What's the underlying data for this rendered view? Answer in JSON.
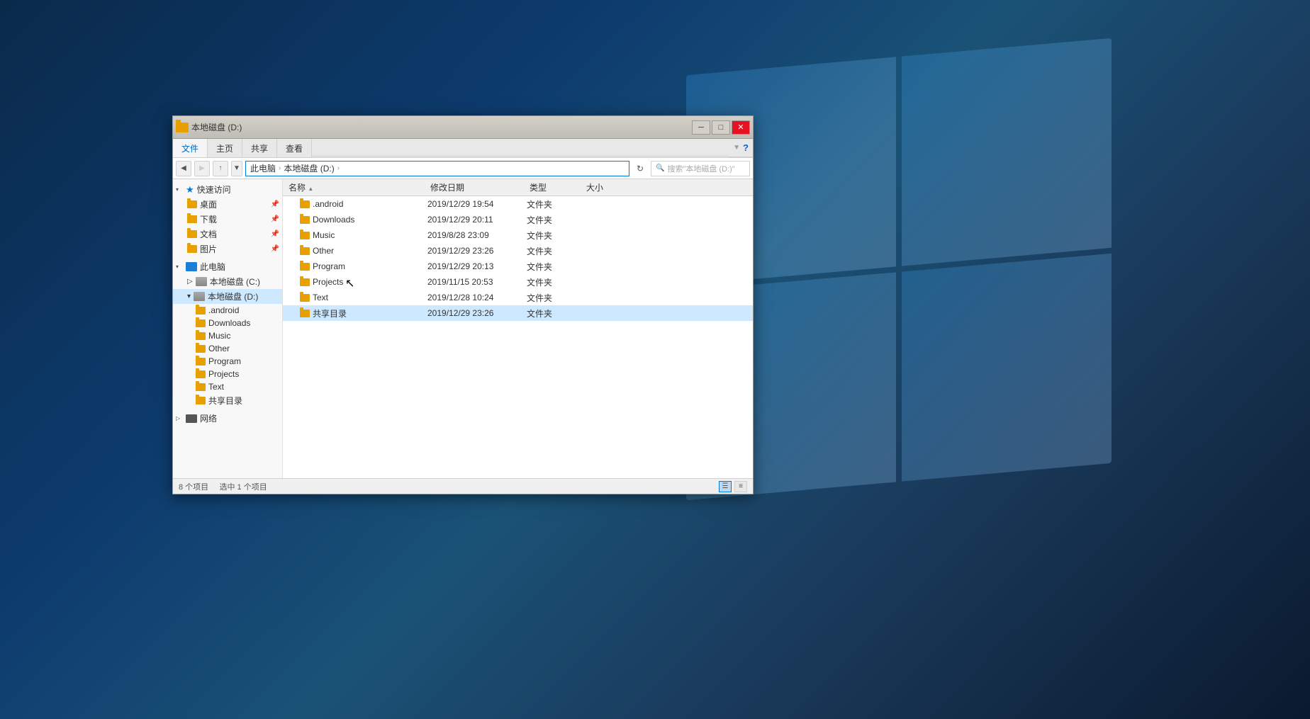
{
  "background": {
    "description": "Windows 10 desktop background - dark blue gradient with Windows logo"
  },
  "window": {
    "title": "本地磁盘 (D:)",
    "title_prefix": "本地磁盘 (D:)"
  },
  "title_bar": {
    "minimize": "─",
    "maximize": "□",
    "close": "✕"
  },
  "ribbon_tabs": [
    {
      "label": "文件",
      "active": true
    },
    {
      "label": "主页",
      "active": false
    },
    {
      "label": "共享",
      "active": false
    },
    {
      "label": "查看",
      "active": false
    }
  ],
  "address_bar": {
    "back": "←",
    "forward": "→",
    "up": "↑",
    "recent": "▼",
    "breadcrumbs": [
      "此电脑",
      "本地磁盘 (D:)"
    ],
    "refresh": "↻",
    "search_placeholder": "搜索\"本地磁盘 (D:)\""
  },
  "sidebar": {
    "sections": [
      {
        "header": "快速访问",
        "icon": "star",
        "expanded": true,
        "items": [
          {
            "label": "桌面",
            "pinned": true
          },
          {
            "label": "下载",
            "pinned": true
          },
          {
            "label": "文档",
            "pinned": true
          },
          {
            "label": "图片",
            "pinned": true
          }
        ]
      },
      {
        "header": "此电脑",
        "icon": "computer",
        "expanded": true,
        "items": [
          {
            "label": "本地磁盘 (C:)",
            "type": "drive"
          },
          {
            "label": "本地磁盘 (D:)",
            "type": "drive",
            "selected": true
          },
          {
            "label": ".android",
            "type": "folder"
          },
          {
            "label": "Downloads",
            "type": "folder"
          },
          {
            "label": "Music",
            "type": "folder"
          },
          {
            "label": "Other",
            "type": "folder"
          },
          {
            "label": "Program",
            "type": "folder"
          },
          {
            "label": "Projects",
            "type": "folder"
          },
          {
            "label": "Text",
            "type": "folder"
          },
          {
            "label": "共享目录",
            "type": "folder"
          }
        ]
      },
      {
        "header": "网络",
        "icon": "network",
        "expanded": false,
        "items": []
      }
    ]
  },
  "file_list": {
    "columns": [
      {
        "label": "名称",
        "sort": "asc"
      },
      {
        "label": "修改日期",
        "sort": null
      },
      {
        "label": "类型",
        "sort": null
      },
      {
        "label": "大小",
        "sort": null
      }
    ],
    "rows": [
      {
        "name": ".android",
        "modified": "2019/12/29 19:54",
        "type": "文件夹",
        "size": "",
        "selected": false
      },
      {
        "name": "Downloads",
        "modified": "2019/12/29 20:11",
        "type": "文件夹",
        "size": "",
        "selected": false
      },
      {
        "name": "Music",
        "modified": "2019/8/28 23:09",
        "type": "文件夹",
        "size": "",
        "selected": false
      },
      {
        "name": "Other",
        "modified": "2019/12/29 23:26",
        "type": "文件夹",
        "size": "",
        "selected": false
      },
      {
        "name": "Program",
        "modified": "2019/12/29 20:13",
        "type": "文件夹",
        "size": "",
        "selected": false
      },
      {
        "name": "Projects",
        "modified": "2019/11/15 20:53",
        "type": "文件夹",
        "size": "",
        "selected": false
      },
      {
        "name": "Text",
        "modified": "2019/12/28 10:24",
        "type": "文件夹",
        "size": "",
        "selected": false
      },
      {
        "name": "共享目录",
        "modified": "2019/12/29 23:26",
        "type": "文件夹",
        "size": "",
        "selected": true
      }
    ]
  },
  "status_bar": {
    "left": "8 个项目",
    "selected": "选中 1 个项目",
    "view_list": "☰",
    "view_detail": "≡"
  }
}
